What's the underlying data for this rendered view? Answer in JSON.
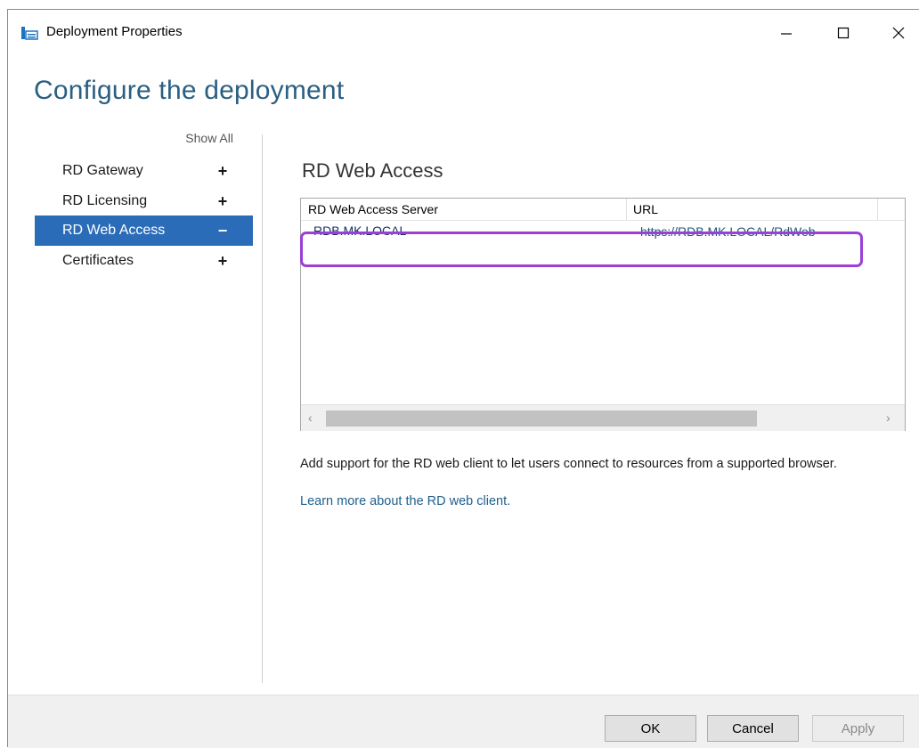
{
  "window": {
    "title": "Deployment Properties",
    "controls": {
      "minimize": "minimize-icon",
      "maximize": "maximize-icon",
      "close": "close-icon"
    }
  },
  "page": {
    "heading": "Configure the deployment"
  },
  "nav": {
    "show_all": "Show All",
    "items": [
      {
        "label": "RD Gateway",
        "sign": "+",
        "active": false
      },
      {
        "label": "RD Licensing",
        "sign": "+",
        "active": false
      },
      {
        "label": "RD Web Access",
        "sign": "−",
        "active": true
      },
      {
        "label": "Certificates",
        "sign": "+",
        "active": false
      }
    ]
  },
  "content": {
    "section_title": "RD Web Access",
    "grid": {
      "columns": [
        "RD Web Access Server",
        "URL"
      ],
      "rows": [
        {
          "server": "RDB.MK.LOCAL",
          "url": "https://RDB.MK.LOCAL/RdWeb"
        }
      ]
    },
    "description": "Add support for the RD web client to let users connect to resources from a supported browser.",
    "learn_more": "Learn more about the RD web client."
  },
  "footer": {
    "ok_label": "OK",
    "cancel_label": "Cancel",
    "apply_label": "Apply"
  },
  "colors": {
    "heading": "#2a5f82",
    "nav_active_bg": "#2b6cb8",
    "highlight_border": "#9b3fd6",
    "link": "#1f5f8c"
  }
}
